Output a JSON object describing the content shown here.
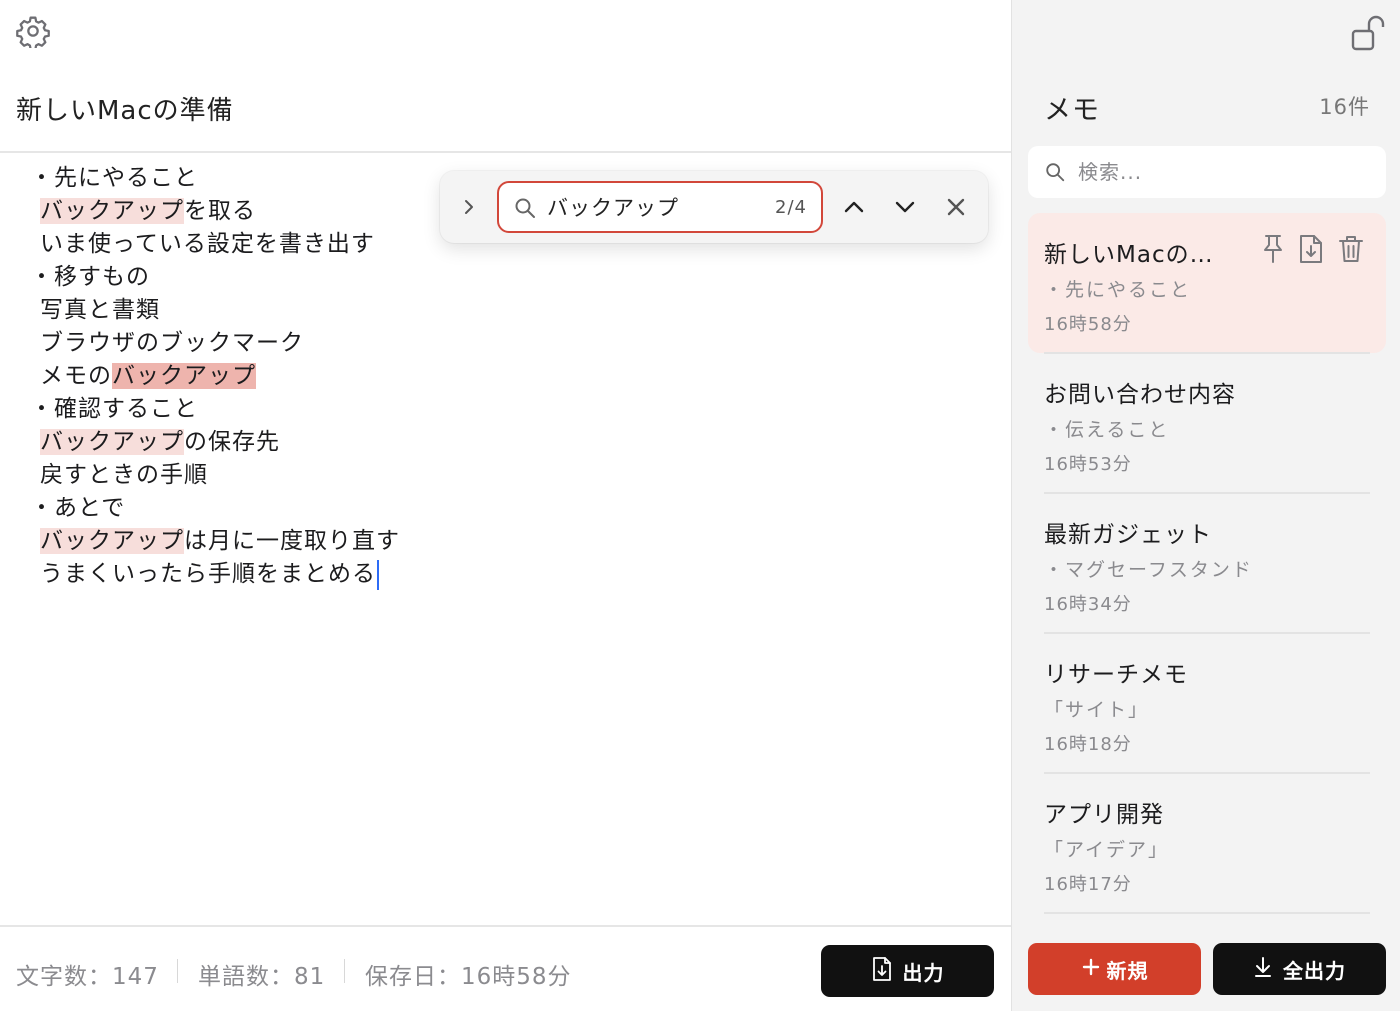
{
  "editor": {
    "title": "新しいMacの準備",
    "lines": [
      {
        "type": "bullet",
        "segments": [
          {
            "text": "・先にやること"
          }
        ]
      },
      {
        "type": "text",
        "segments": [
          {
            "text": "バックアップ",
            "hl": "match"
          },
          {
            "text": "を取る"
          }
        ]
      },
      {
        "type": "text",
        "segments": [
          {
            "text": "いま使っている設定を書き出す"
          }
        ]
      },
      {
        "type": "bullet",
        "segments": [
          {
            "text": "・移すもの"
          }
        ]
      },
      {
        "type": "text",
        "segments": [
          {
            "text": "写真と書類"
          }
        ]
      },
      {
        "type": "text",
        "segments": [
          {
            "text": "ブラウザのブックマーク"
          }
        ]
      },
      {
        "type": "text",
        "segments": [
          {
            "text": "メモの"
          },
          {
            "text": "バックアップ",
            "hl": "current"
          }
        ]
      },
      {
        "type": "bullet",
        "segments": [
          {
            "text": "・確認すること"
          }
        ]
      },
      {
        "type": "text",
        "segments": [
          {
            "text": "バックアップ",
            "hl": "match"
          },
          {
            "text": "の保存先"
          }
        ]
      },
      {
        "type": "text",
        "segments": [
          {
            "text": "戻すときの手順"
          }
        ]
      },
      {
        "type": "bullet",
        "segments": [
          {
            "text": "・あとで"
          }
        ]
      },
      {
        "type": "text",
        "segments": [
          {
            "text": "バックアップ",
            "hl": "match"
          },
          {
            "text": "は月に一度取り直す"
          }
        ]
      },
      {
        "type": "text",
        "segments": [
          {
            "text": "うまくいったら手順をまとめる"
          }
        ],
        "caret": true
      }
    ]
  },
  "find": {
    "query": "バックアップ",
    "count": "2/4"
  },
  "status": {
    "chars": "文字数：147",
    "words": "単語数：81",
    "saved": "保存日：16時58分",
    "export_label": "出力"
  },
  "sidebar": {
    "title": "メモ",
    "count": "16件",
    "search_placeholder": "検索...",
    "notes": [
      {
        "title": "新しいMacの…",
        "preview": "・先にやること",
        "time": "16時58分",
        "active": true
      },
      {
        "title": "お問い合わせ内容",
        "preview": "・伝えること",
        "time": "16時53分"
      },
      {
        "title": "最新ガジェット",
        "preview": "・マグセーフスタンド",
        "time": "16時34分"
      },
      {
        "title": "リサーチメモ",
        "preview": "「サイト」",
        "time": "16時18分"
      },
      {
        "title": "アプリ開発",
        "preview": "「アイデア」",
        "time": "16時17分"
      }
    ],
    "new_label": "新規",
    "export_all_label": "全出力"
  },
  "colors": {
    "accent_red": "#d23f2a",
    "highlight_match": "#f7dedb",
    "highlight_current": "#eeb4ad",
    "active_note_bg": "#fbeae7",
    "caret": "#2d6cf6"
  },
  "icons": [
    "gear-icon",
    "chevron-right-icon",
    "search-icon",
    "chevron-up-icon",
    "chevron-down-icon",
    "close-icon",
    "export-file-icon",
    "lock-open-icon",
    "pin-icon",
    "trash-icon",
    "plus-icon",
    "download-icon"
  ]
}
